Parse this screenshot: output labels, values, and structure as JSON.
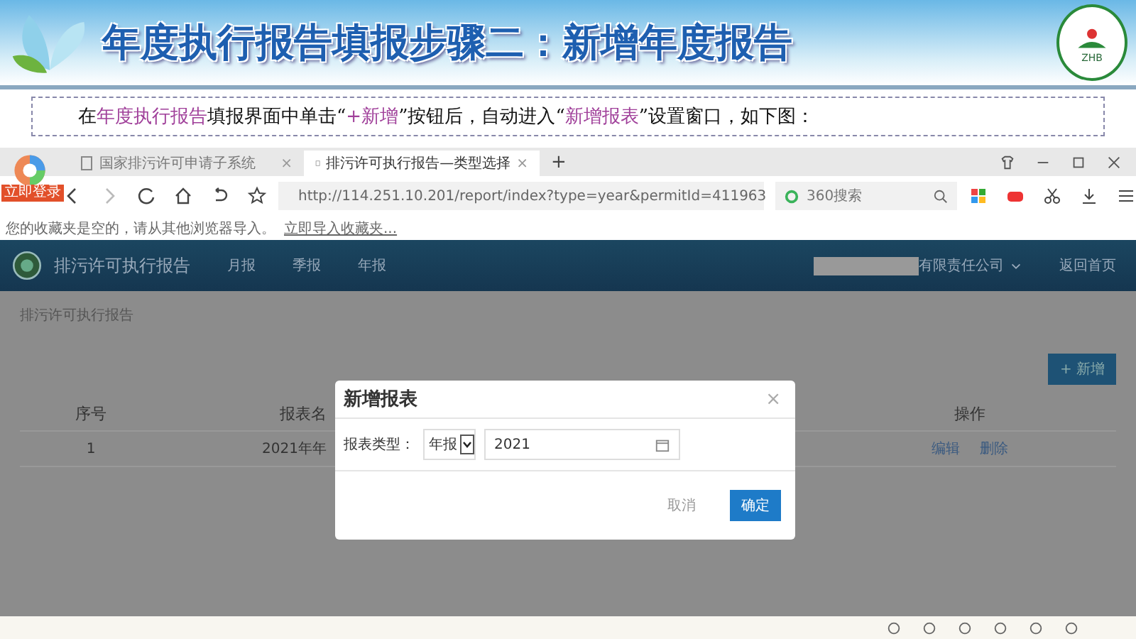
{
  "slide": {
    "title": "年度执行报告填报步骤二：新增年度报告",
    "logo_text": "ZHB",
    "instruction": [
      {
        "text": "在",
        "highlight": false
      },
      {
        "text": "年度执行报告",
        "highlight": true
      },
      {
        "text": "填报界面中单击“",
        "highlight": false
      },
      {
        "text": "+新增",
        "highlight": true
      },
      {
        "text": "”按钮后，自动进入“",
        "highlight": false
      },
      {
        "text": "新增报表",
        "highlight": true
      },
      {
        "text": "”设置窗口，如下图：",
        "highlight": false
      }
    ]
  },
  "browser": {
    "login_badge": "立即登录",
    "tabs": [
      {
        "title": "国家排污许可申请子系统",
        "close": "×",
        "selected": false
      },
      {
        "title": "排污许可执行报告—类型选择",
        "close": "×",
        "selected": true
      }
    ],
    "new_tab": "+",
    "url": "http://114.251.10.201/report/index?type=year&permitId=411963",
    "search_placeholder": "360搜索",
    "bookmarks_notice": "您的收藏夹是空的，请从其他浏览器导入。",
    "bookmarks_link": "立即导入收藏夹..."
  },
  "app": {
    "title": "排污许可执行报告",
    "nav": [
      {
        "label": "月报"
      },
      {
        "label": "季报"
      },
      {
        "label": "年报"
      }
    ],
    "company": "有限责任公司",
    "home_link": "返回首页",
    "breadcrumb": "排污许可执行报告",
    "add_button": "+ 新增",
    "table": {
      "columns": [
        "序号",
        "报表名",
        "操作"
      ],
      "rows": [
        {
          "index": "1",
          "name": "2021年年",
          "actions": [
            "编辑",
            "删除"
          ]
        }
      ]
    }
  },
  "dialog": {
    "title": "新增报表",
    "close": "×",
    "field_label": "报表类型：",
    "type_value": "年报",
    "year_value": "2021",
    "buttons": [
      {
        "label": "取消",
        "kind": "secondary"
      },
      {
        "label": "确定",
        "kind": "primary"
      }
    ]
  }
}
